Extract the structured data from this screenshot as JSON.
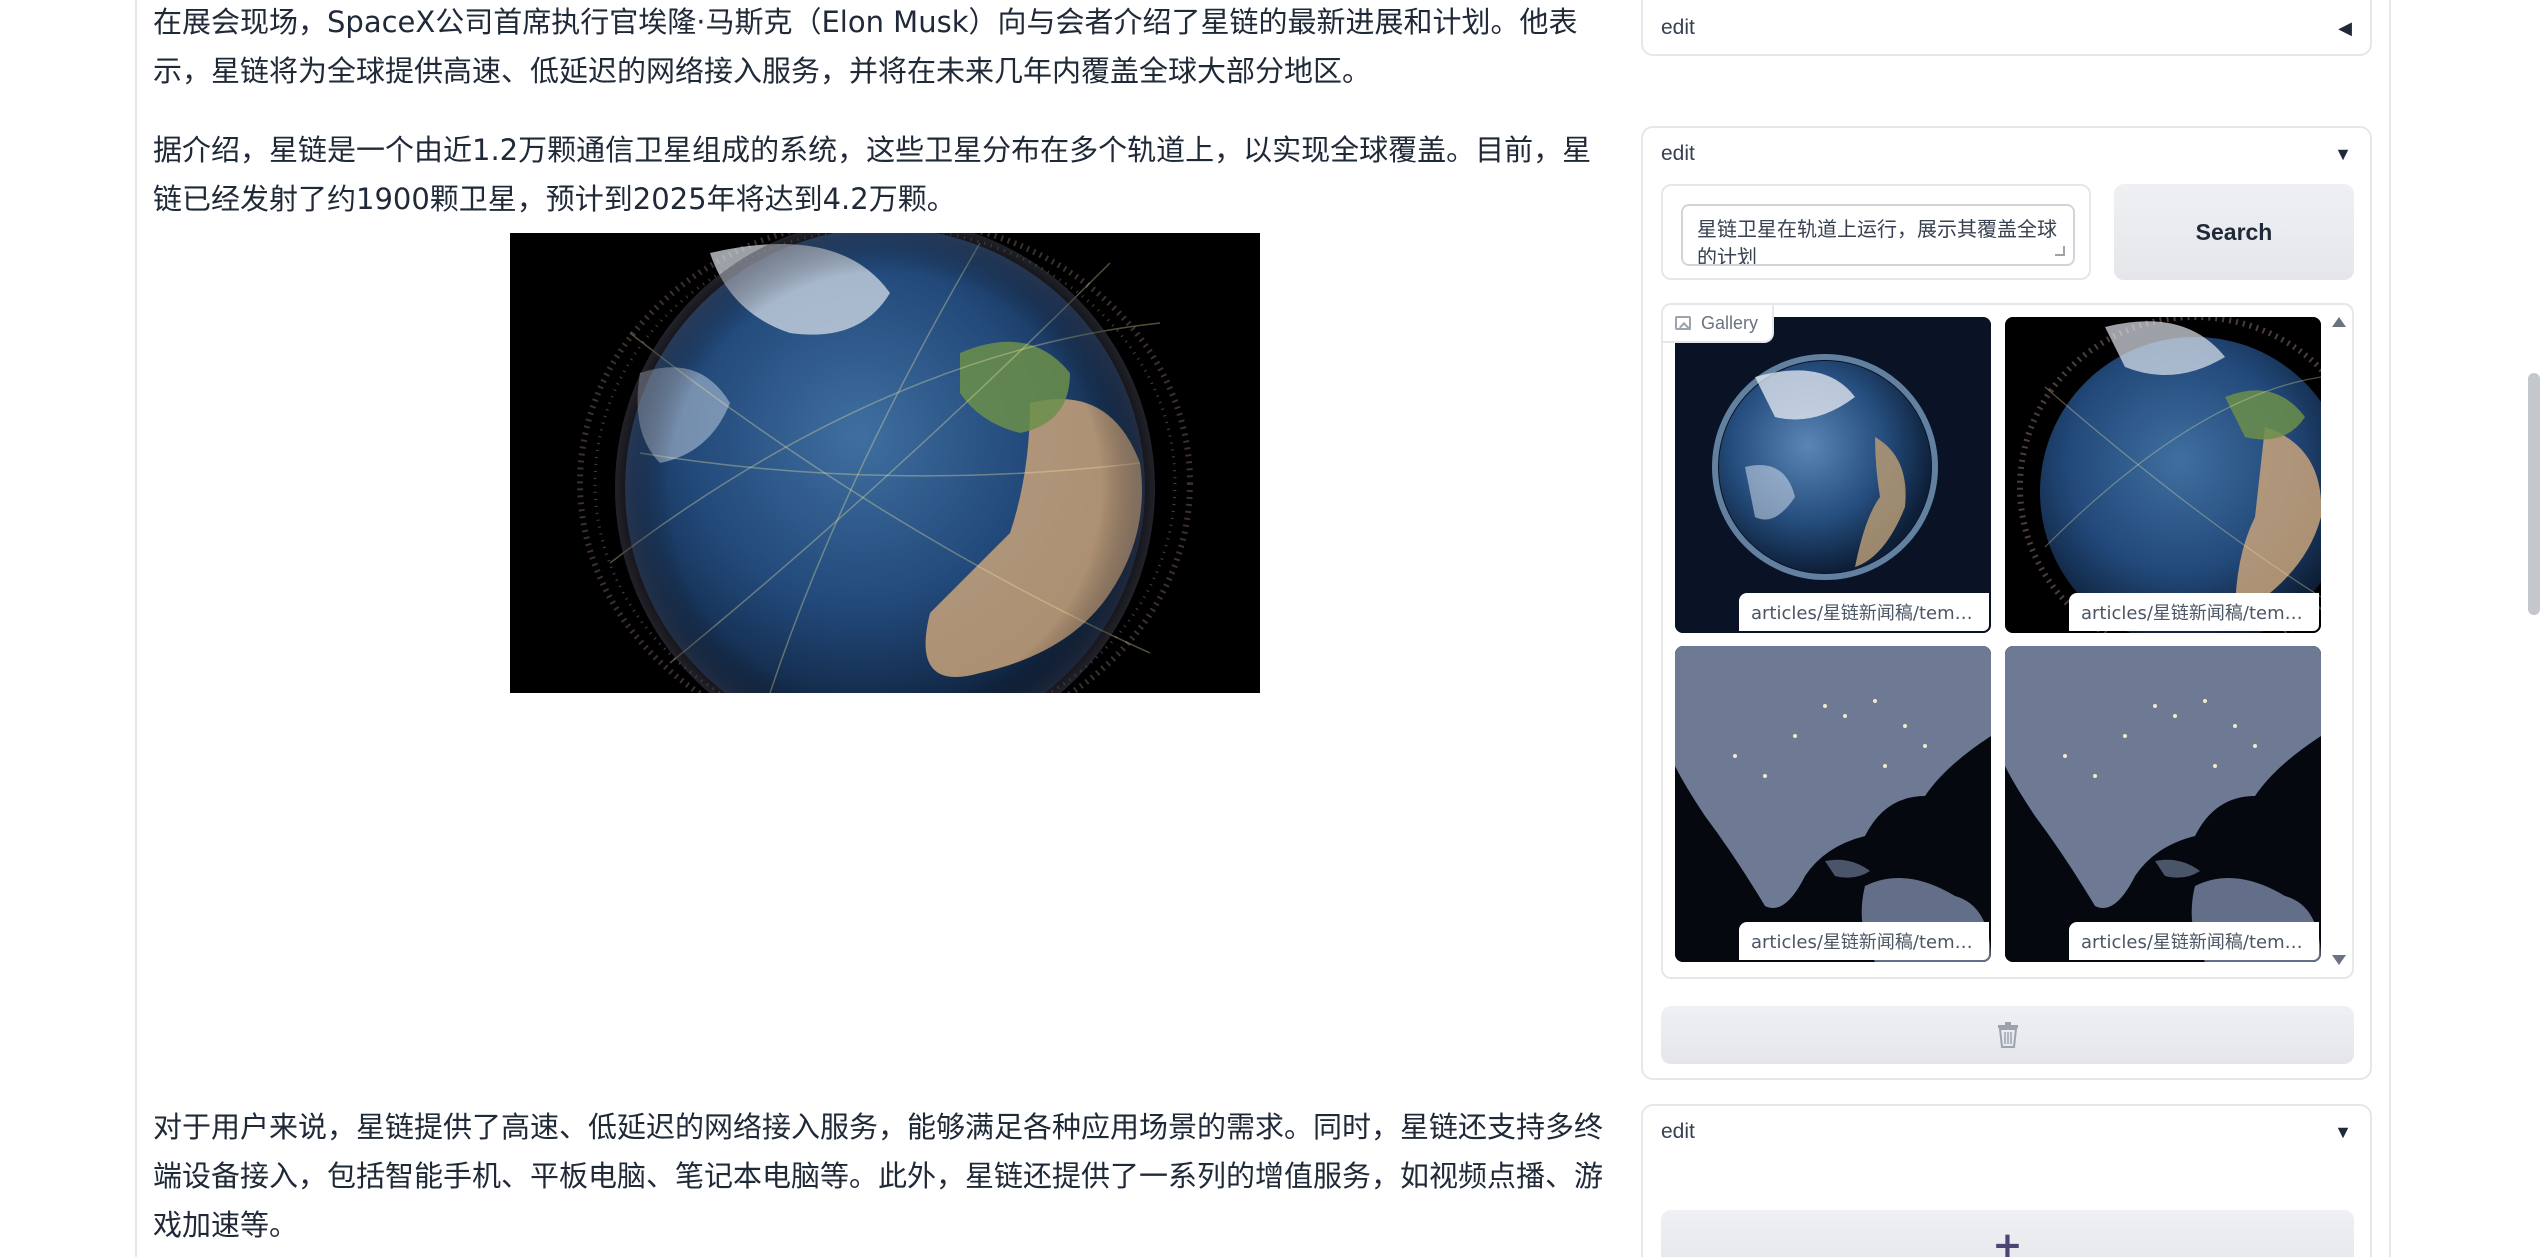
{
  "article": {
    "paragraph_1": "在展会现场，SpaceX公司首席执行官埃隆·马斯克（Elon Musk）向与会者介绍了星链的最新进展和计划。他表示，星链将为全球提供高速、低延迟的网络接入服务，并将在未来几年内覆盖全球大部分地区。",
    "paragraph_2": "据介绍，星链是一个由近1.2万颗通信卫星组成的系统，这些卫星分布在多个轨道上，以实现全球覆盖。目前，星链已经发射了约1900颗卫星，预计到2025年将达到4.2万颗。",
    "paragraph_3": "对于用户来说，星链提供了高速、低延迟的网络接入服务，能够满足各种应用场景的需求。同时，星链还支持多终端设备接入，包括智能手机、平板电脑、笔记本电脑等。此外，星链还提供了一系列的增值服务，如视频点播、游戏加速等。"
  },
  "blocks": [
    {
      "label": "edit",
      "caret": "◀"
    },
    {
      "label": "edit",
      "caret": "▼"
    },
    {
      "label": "edit",
      "caret": "▼"
    }
  ],
  "search": {
    "query": "星链卫星在轨道上运行，展示其覆盖全球的计划",
    "button_label": "Search"
  },
  "gallery": {
    "label": "Gallery",
    "items": [
      {
        "caption": "articles/星链新闻稿/temp_..."
      },
      {
        "caption": "articles/星链新闻稿/temp_..."
      },
      {
        "caption": "articles/星链新闻稿/temp_..."
      },
      {
        "caption": "articles/星链新闻稿/temp_..."
      }
    ]
  },
  "actions": {
    "add_label": "+"
  },
  "icons": {
    "gallery": "image-icon",
    "delete": "trash-icon",
    "add": "plus-icon"
  }
}
